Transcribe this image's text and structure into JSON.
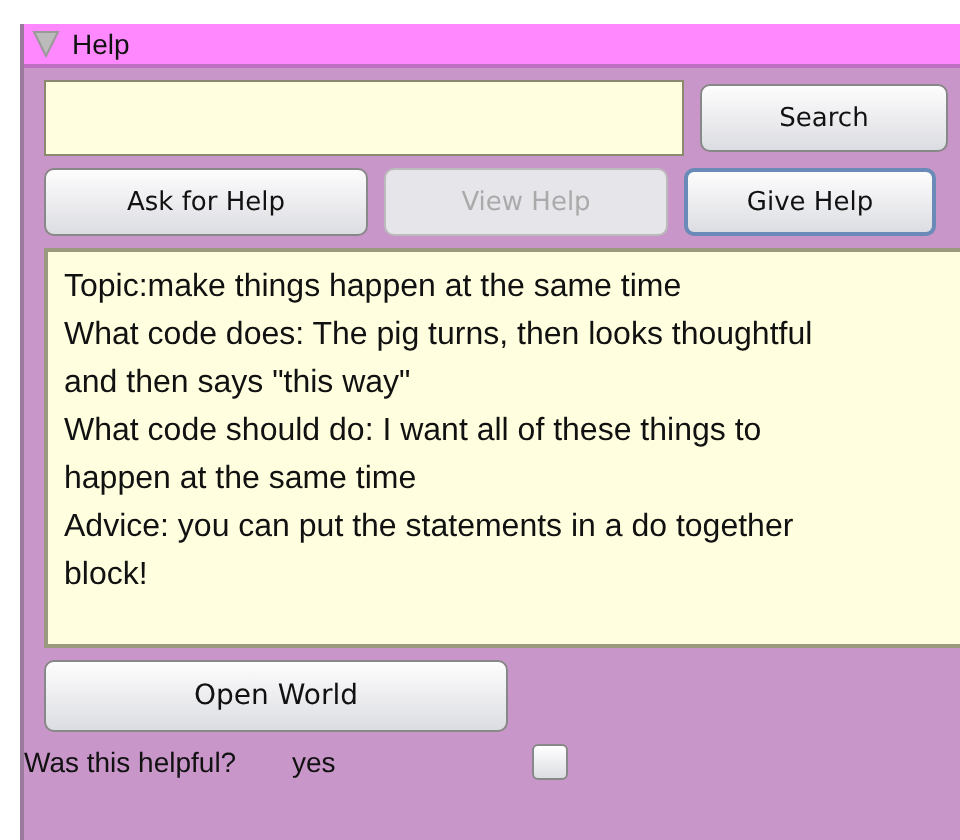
{
  "panel": {
    "title": "Help",
    "expanded": true
  },
  "search": {
    "button": "Search"
  },
  "buttons": [
    {
      "label": "Ask for Help",
      "disabled": false,
      "focused": false
    },
    {
      "label": "View Help",
      "disabled": true,
      "focused": false
    },
    {
      "label": "Give Help",
      "disabled": false,
      "focused": true
    }
  ],
  "help_text": [
    "Topic:make things happen at the same time",
    "What code does: The pig turns, then looks thoughtful and then says \"this way\"",
    "What code should do: I want all of these things to happen at the same time",
    "Advice: you can put the statements in a do together block!"
  ],
  "open_button": "Open World",
  "feedback": {
    "question": "Was this helpful?",
    "option": "yes",
    "checked": false
  }
}
